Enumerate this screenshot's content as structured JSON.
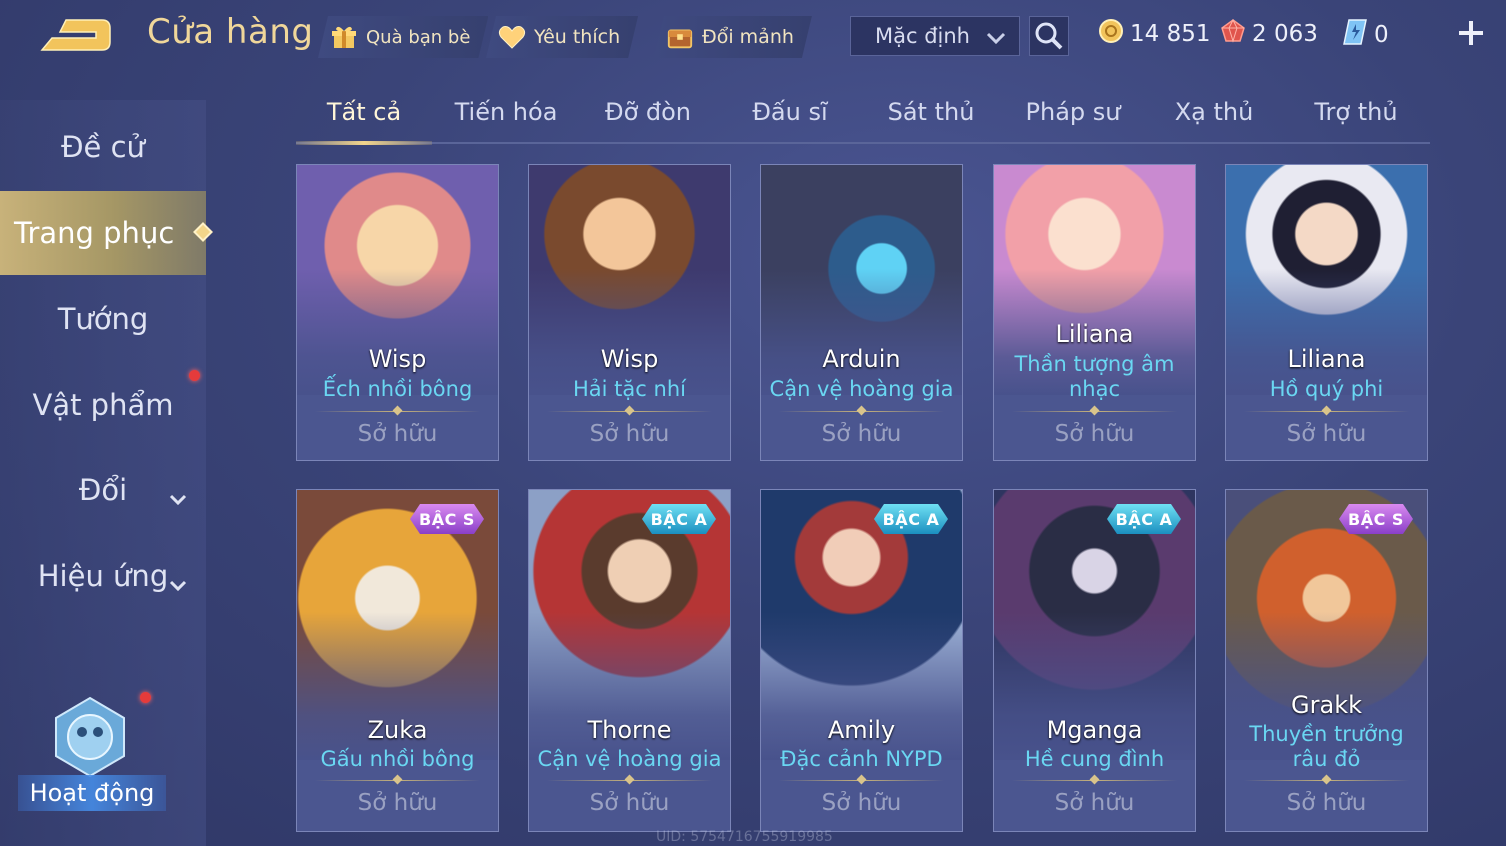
{
  "header": {
    "title": "Cửa hàng",
    "pills": [
      {
        "label": "Quà bạn bè",
        "icon": "gift-icon"
      },
      {
        "label": "Yêu thích",
        "icon": "heart-icon"
      },
      {
        "label": "Đổi mảnh",
        "icon": "chest-icon"
      }
    ],
    "sort": {
      "selected": "Mặc định"
    },
    "currencies": [
      {
        "icon": "gold-coin-icon",
        "value": "14 851"
      },
      {
        "icon": "ruby-icon",
        "value": "2 063"
      },
      {
        "icon": "voucher-icon",
        "value": "0"
      }
    ]
  },
  "sidebar": {
    "items": [
      {
        "label": "Đề cử"
      },
      {
        "label": "Trang phục"
      },
      {
        "label": "Tướng"
      },
      {
        "label": "Vật phẩm"
      },
      {
        "label": "Đổi"
      },
      {
        "label": "Hiệu ứng"
      }
    ],
    "activity_label": "Hoạt động"
  },
  "tabs": [
    "Tất cả",
    "Tiến hóa",
    "Đỡ đòn",
    "Đấu sĩ",
    "Sát thủ",
    "Pháp sư",
    "Xạ thủ",
    "Trợ thủ"
  ],
  "cards": [
    {
      "hero": "Wisp",
      "skin": "Ếch nhồi bông",
      "status": "Sở hữu",
      "badge": ""
    },
    {
      "hero": "Wisp",
      "skin": "Hải tặc nhí",
      "status": "Sở hữu",
      "badge": ""
    },
    {
      "hero": "Arduin",
      "skin": "Cận vệ hoàng gia",
      "status": "Sở hữu",
      "badge": ""
    },
    {
      "hero": "Liliana",
      "skin": "Thần tượng âm nhạc",
      "status": "Sở hữu",
      "badge": ""
    },
    {
      "hero": "Liliana",
      "skin": "Hồ quý phi",
      "status": "Sở hữu",
      "badge": ""
    },
    {
      "hero": "Zuka",
      "skin": "Gấu nhồi bông",
      "status": "Sở hữu",
      "badge": "BẬC S"
    },
    {
      "hero": "Thorne",
      "skin": "Cận vệ hoàng gia",
      "status": "Sở hữu",
      "badge": "BẬC A"
    },
    {
      "hero": "Amily",
      "skin": "Đặc cảnh NYPD",
      "status": "Sở hữu",
      "badge": "BẬC A"
    },
    {
      "hero": "Mganga",
      "skin": "Hề cung đình",
      "status": "Sở hữu",
      "badge": "BẬC A"
    },
    {
      "hero": "Grakk",
      "skin": "Thuyền trưởng râu đỏ",
      "status": "Sở hữu",
      "badge": "BẬC S"
    }
  ],
  "footer": {
    "uid": "UID: 5754716755919985"
  }
}
